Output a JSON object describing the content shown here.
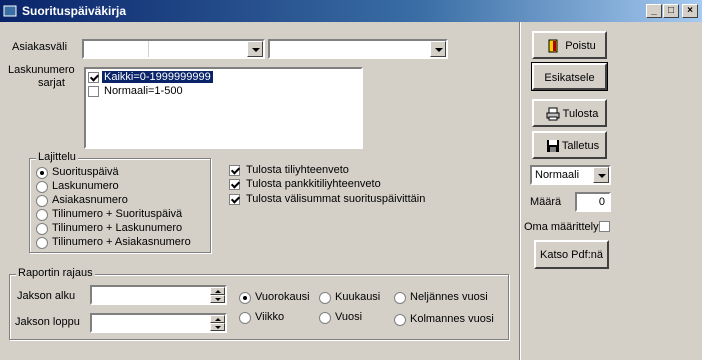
{
  "window": {
    "title": "Suorituspäiväkirja",
    "minimize": "_",
    "maximize": "□",
    "close": "×"
  },
  "customer_range": {
    "label": "Asiakasväli",
    "from_value": "",
    "to_value": ""
  },
  "invoice_series": {
    "label_line1": "Laskunumero",
    "label_line2": "sarjat",
    "items": [
      {
        "label": "Kaikki=0-1999999999",
        "checked": true,
        "selected": true
      },
      {
        "label": "Normaali=1-500",
        "checked": false,
        "selected": false
      }
    ]
  },
  "sorting": {
    "legend": "Lajittelu",
    "options": [
      {
        "label": "Suorituspäivä",
        "checked": true
      },
      {
        "label": "Laskunumero",
        "checked": false
      },
      {
        "label": "Asiakasnumero",
        "checked": false
      },
      {
        "label": "Tilinumero + Suorituspäivä",
        "checked": false
      },
      {
        "label": "Tilinumero + Laskunumero",
        "checked": false
      },
      {
        "label": "Tilinumero + Asiakasnumero",
        "checked": false
      }
    ]
  },
  "print_options": [
    {
      "label": "Tulosta tiliyhteenveto",
      "checked": true
    },
    {
      "label": "Tulosta pankkitiliyhteenveto",
      "checked": true
    },
    {
      "label": "Tulosta välisummat suorituspäivittäin",
      "checked": true
    }
  ],
  "report_limit": {
    "legend": "Raportin rajaus",
    "period_start_label": "Jakson alku",
    "period_end_label": "Jakson loppu",
    "period_start_value": "",
    "period_end_value": "",
    "periods": [
      {
        "label": "Vuorokausi",
        "checked": true
      },
      {
        "label": "Kuukausi",
        "checked": false
      },
      {
        "label": "Neljännes vuosi",
        "checked": false
      },
      {
        "label": "Viikko",
        "checked": false
      },
      {
        "label": "Vuosi",
        "checked": false
      },
      {
        "label": "Kolmannes vuosi",
        "checked": false
      }
    ]
  },
  "actions": {
    "exit": "Poistu",
    "preview": "Esikatsele",
    "print": "Tulosta",
    "save": "Talletus",
    "view_pdf": "Katso Pdf:nä"
  },
  "print_mode": {
    "value": "Normaali"
  },
  "quantity": {
    "label": "Määrä",
    "value": "0"
  },
  "own_definition": {
    "label": "Oma määrittely",
    "checked": false
  },
  "icons": [
    "door-exit-icon",
    "printer-icon",
    "floppy-disk-icon"
  ]
}
